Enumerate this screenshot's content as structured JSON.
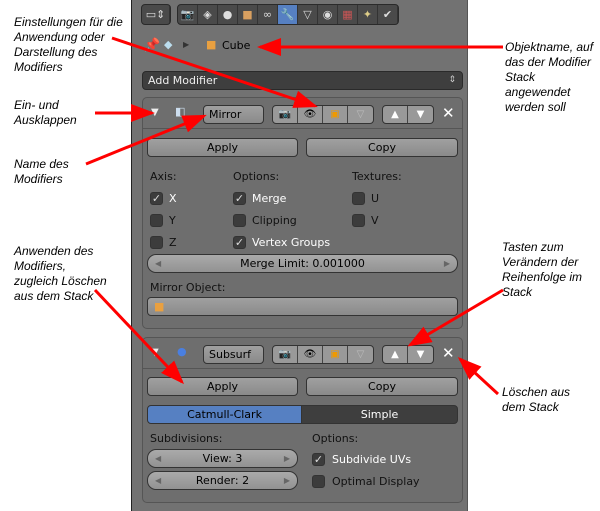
{
  "header": {
    "tabs": [
      "render",
      "scene",
      "world",
      "object",
      "constraints",
      "modifiers",
      "data",
      "material",
      "texture",
      "particles",
      "physics"
    ],
    "active_tab": "modifiers"
  },
  "breadcrumb": {
    "object": "Cube"
  },
  "add_modifier": {
    "label": "Add Modifier"
  },
  "mirror": {
    "name": "Mirror",
    "apply": "Apply",
    "copy": "Copy",
    "axis_label": "Axis:",
    "options_label": "Options:",
    "textures_label": "Textures:",
    "axis": [
      {
        "label": "X",
        "checked": true
      },
      {
        "label": "Y",
        "checked": false
      },
      {
        "label": "Z",
        "checked": false
      }
    ],
    "options": [
      {
        "label": "Merge",
        "checked": true
      },
      {
        "label": "Clipping",
        "checked": false
      },
      {
        "label": "Vertex Groups",
        "checked": true
      }
    ],
    "textures": [
      {
        "label": "U",
        "checked": false
      },
      {
        "label": "V",
        "checked": false
      }
    ],
    "merge_limit": "Merge Limit: 0.001000",
    "mirror_object_label": "Mirror Object:"
  },
  "subsurf": {
    "name": "Subsurf",
    "apply": "Apply",
    "copy": "Copy",
    "mode_a": "Catmull-Clark",
    "mode_b": "Simple",
    "active_mode": "Catmull-Clark",
    "subdivisions_label": "Subdivisions:",
    "view": "View: 3",
    "render": "Render: 2",
    "options_label": "Options:",
    "options": [
      {
        "label": "Subdivide UVs",
        "checked": true
      },
      {
        "label": "Optimal Display",
        "checked": false
      }
    ]
  },
  "annotations": {
    "settings": "Einstellungen für die Anwendung oder Darstellung des Modifiers",
    "objectname": "Objektname, auf das der Modifier Stack angewendet werden soll",
    "collapse": "Ein- und Ausklappen",
    "name": "Name des Modifiers",
    "apply": "Anwenden des Modifiers, zugleich Löschen aus dem Stack",
    "order": "Tasten zum Verändern der Reihenfolge im Stack",
    "delete": "Löschen aus dem Stack"
  },
  "colors": {
    "panel": "#727272",
    "accent": "#5680c2",
    "arrow": "#ff0000"
  }
}
